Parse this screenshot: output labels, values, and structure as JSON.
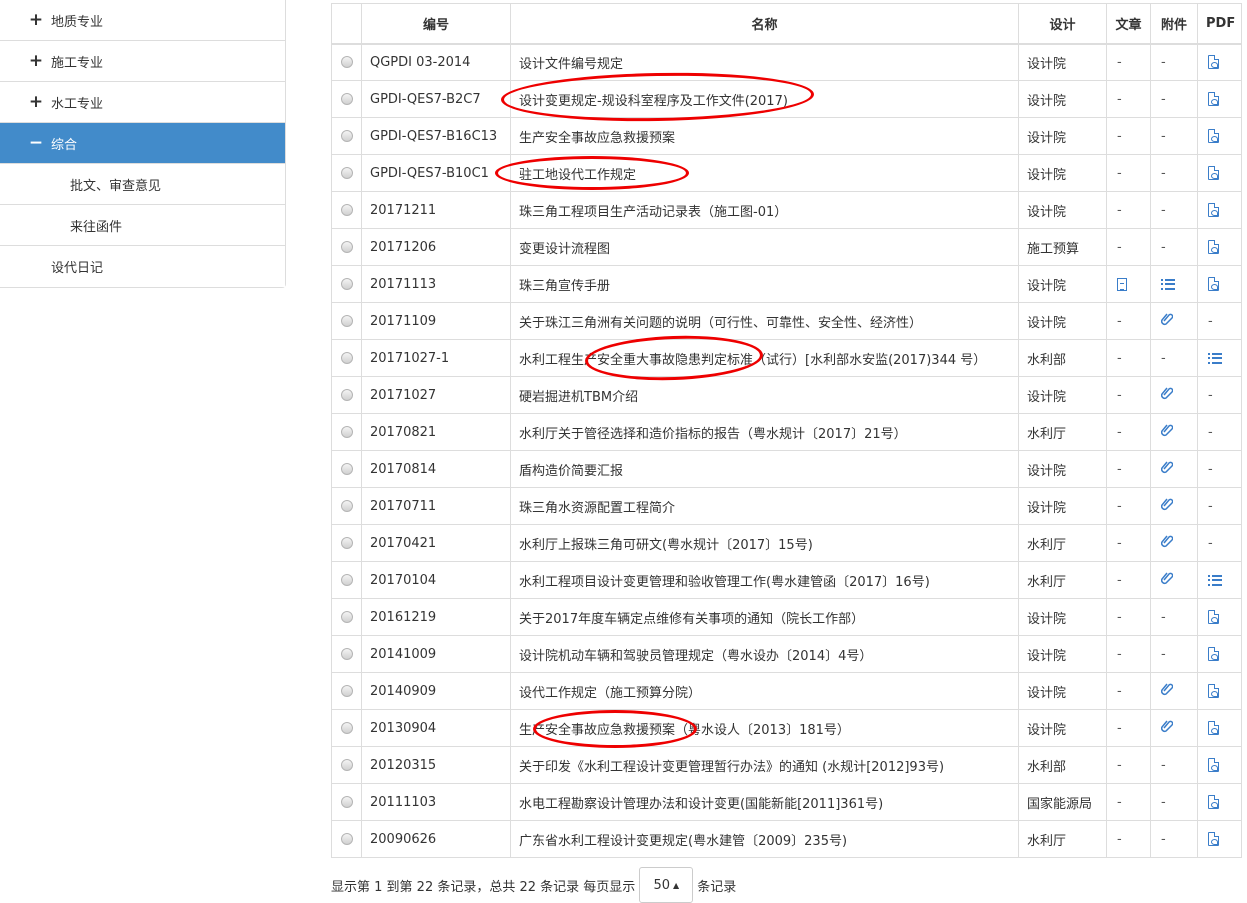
{
  "sidebar": {
    "items": [
      {
        "label": "地质专业",
        "symbol": "+"
      },
      {
        "label": "施工专业",
        "symbol": "+"
      },
      {
        "label": "水工专业",
        "symbol": "+"
      },
      {
        "label": "综合",
        "symbol": "−"
      },
      {
        "label": "批文、审查意见"
      },
      {
        "label": "来往函件"
      },
      {
        "label": "设代日记"
      }
    ]
  },
  "table": {
    "headers": [
      "编号",
      "名称",
      "设计",
      "文章",
      "附件",
      "PDF"
    ],
    "rows": [
      {
        "code": "QGPDI 03-2014",
        "name": "设计文件编号规定",
        "design": "设计院",
        "article": "-",
        "attach": "-",
        "pdf": "pdf-icon"
      },
      {
        "code": "GPDI-QES7-B2C7",
        "name": "设计变更规定-规设科室程序及工作文件(2017)",
        "design": "设计院",
        "article": "-",
        "attach": "-",
        "pdf": "pdf-icon"
      },
      {
        "code": "GPDI-QES7-B16C13",
        "name": "生产安全事故应急救援预案",
        "design": "设计院",
        "article": "-",
        "attach": "-",
        "pdf": "pdf-icon"
      },
      {
        "code": "GPDI-QES7-B10C1",
        "name": "驻工地设代工作规定",
        "design": "设计院",
        "article": "-",
        "attach": "-",
        "pdf": "pdf-icon"
      },
      {
        "code": "20171211",
        "name": "珠三角工程项目生产活动记录表（施工图-01）",
        "design": "设计院",
        "article": "-",
        "attach": "-",
        "pdf": "pdf-icon"
      },
      {
        "code": "20171206",
        "name": "变更设计流程图",
        "design": "施工预算",
        "article": "-",
        "attach": "-",
        "pdf": "pdf-icon"
      },
      {
        "code": "20171113",
        "name": "珠三角宣传手册",
        "design": "设计院",
        "article": "doc-icon",
        "attach": "list-icon",
        "pdf": "pdf-icon"
      },
      {
        "code": "20171109",
        "name": "关于珠江三角洲有关问题的说明（可行性、可靠性、安全性、经济性）",
        "design": "设计院",
        "article": "-",
        "attach": "paperclip-icon",
        "pdf": "-"
      },
      {
        "code": "20171027-1",
        "name": "水利工程生产安全重大事故隐患判定标准（试行）[水利部水安监(2017)344 号）",
        "design": "水利部",
        "article": "-",
        "attach": "-",
        "pdf": "list-icon"
      },
      {
        "code": "20171027",
        "name": "硬岩掘进机TBM介绍",
        "design": "设计院",
        "article": "-",
        "attach": "paperclip-icon",
        "pdf": "-"
      },
      {
        "code": "20170821",
        "name": "水利厅关于管径选择和造价指标的报告（粤水规计〔2017〕21号）",
        "design": "水利厅",
        "article": "-",
        "attach": "paperclip-icon",
        "pdf": "-"
      },
      {
        "code": "20170814",
        "name": "盾构造价简要汇报",
        "design": "设计院",
        "article": "-",
        "attach": "paperclip-icon",
        "pdf": "-"
      },
      {
        "code": "20170711",
        "name": "珠三角水资源配置工程简介",
        "design": "设计院",
        "article": "-",
        "attach": "paperclip-icon",
        "pdf": "-"
      },
      {
        "code": "20170421",
        "name": "水利厅上报珠三角可研文(粤水规计〔2017〕15号)",
        "design": "水利厅",
        "article": "-",
        "attach": "paperclip-icon",
        "pdf": "-"
      },
      {
        "code": "20170104",
        "name": "水利工程项目设计变更管理和验收管理工作(粤水建管函〔2017〕16号)",
        "design": "水利厅",
        "article": "-",
        "attach": "paperclip-icon",
        "pdf": "list-icon"
      },
      {
        "code": "20161219",
        "name": "关于2017年度车辆定点维修有关事项的通知（院长工作部）",
        "design": "设计院",
        "article": "-",
        "attach": "-",
        "pdf": "pdf-icon"
      },
      {
        "code": "20141009",
        "name": "设计院机动车辆和驾驶员管理规定（粤水设办〔2014〕4号）",
        "design": "设计院",
        "article": "-",
        "attach": "-",
        "pdf": "pdf-icon"
      },
      {
        "code": "20140909",
        "name": "设代工作规定（施工预算分院）",
        "design": "设计院",
        "article": "-",
        "attach": "paperclip-icon",
        "pdf": "pdf-icon"
      },
      {
        "code": "20130904",
        "name": "生产安全事故应急救援预案（粤水设人〔2013〕181号）",
        "design": "设计院",
        "article": "-",
        "attach": "paperclip-icon",
        "pdf": "pdf-icon"
      },
      {
        "code": "20120315",
        "name": "关于印发《水利工程设计变更管理暂行办法》的通知 (水规计[2012]93号)",
        "design": "水利部",
        "article": "-",
        "attach": "-",
        "pdf": "pdf-icon"
      },
      {
        "code": "20111103",
        "name": "水电工程勘察设计管理办法和设计变更(国能新能[2011]361号)",
        "design": "国家能源局",
        "article": "-",
        "attach": "-",
        "pdf": "pdf-icon"
      },
      {
        "code": "20090626",
        "name": "广东省水利工程设计变更规定(粤水建管〔2009〕235号)",
        "design": "水利厅",
        "article": "-",
        "attach": "-",
        "pdf": "pdf-icon"
      }
    ]
  },
  "pager": {
    "info": "显示第 1 到第 22 条记录，总共 22 条记录 每页显示",
    "page_size": "50",
    "suffix": "条记录"
  },
  "colors": {
    "accent": "#428bca",
    "icon": "#3a7dc9",
    "annotation": "#e00000"
  }
}
